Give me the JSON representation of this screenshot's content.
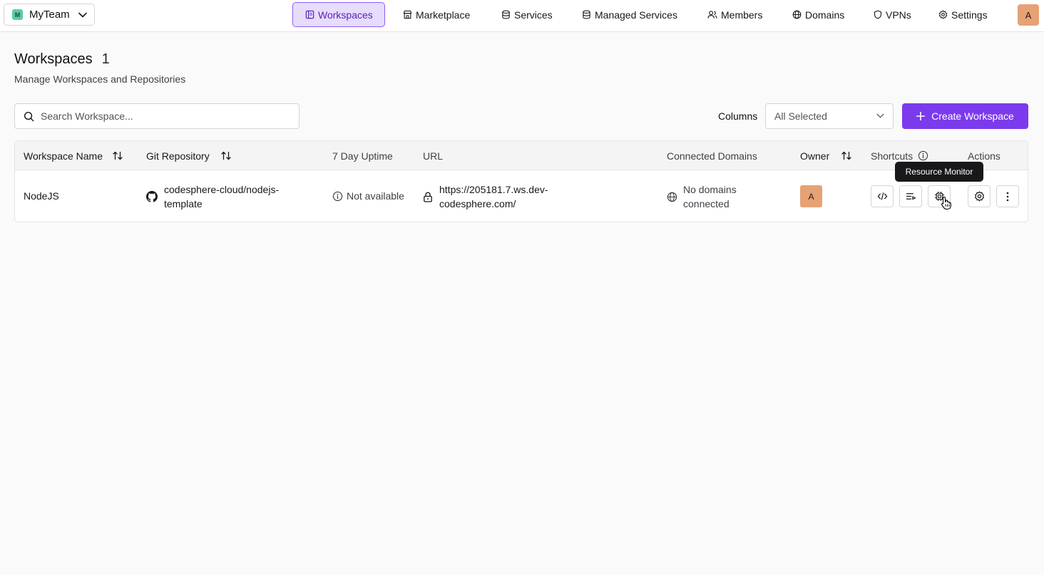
{
  "team": {
    "initial": "M",
    "name": "MyTeam"
  },
  "nav": {
    "workspaces": "Workspaces",
    "marketplace": "Marketplace",
    "services": "Services",
    "managed_services": "Managed Services",
    "members": "Members",
    "domains": "Domains",
    "vpns": "VPNs",
    "settings": "Settings"
  },
  "user": {
    "initial": "A"
  },
  "page": {
    "title": "Workspaces",
    "count": "1",
    "subtitle": "Manage Workspaces and Repositories"
  },
  "toolbar": {
    "search_placeholder": "Search Workspace...",
    "columns_label": "Columns",
    "columns_value": "All Selected",
    "create_label": "Create Workspace"
  },
  "table": {
    "headers": {
      "name": "Workspace Name",
      "git": "Git Repository",
      "uptime": "7 Day Uptime",
      "url": "URL",
      "domains": "Connected Domains",
      "owner": "Owner",
      "shortcuts": "Shortcuts",
      "actions": "Actions"
    },
    "rows": [
      {
        "name": "NodeJS",
        "git_line1": "codesphere-cloud/nodejs-",
        "git_line2": "template",
        "uptime": "Not available",
        "url_line1": "https://205181.7.ws.dev-",
        "url_line2": "codesphere.com/",
        "domains_line1": "No domains",
        "domains_line2": "connected",
        "owner_initial": "A"
      }
    ]
  },
  "tooltip": {
    "text": "Resource Monitor"
  },
  "colors": {
    "accent": "#7c3aed",
    "active_nav_bg": "#e6dcfb",
    "avatar": "#e6a275",
    "team_logo": "#5fc9a8"
  }
}
